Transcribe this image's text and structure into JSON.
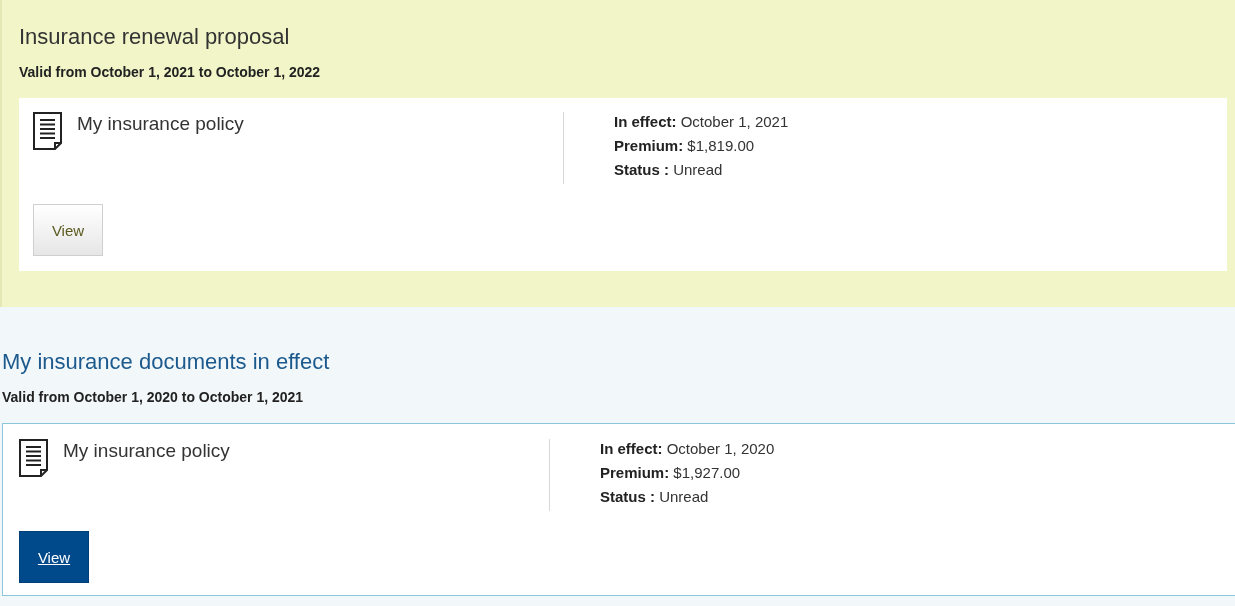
{
  "sections": [
    {
      "kind": "proposal",
      "title": "Insurance renewal proposal",
      "validity": "Valid from October 1, 2021 to October 1, 2022",
      "document": {
        "title": "My insurance policy",
        "details": [
          "**In effect:** October 1, 2021",
          "**Premium:** $1,819.00",
          "**Status :** Unread"
        ],
        "button": "View"
      }
    },
    {
      "kind": "in_effect",
      "title": "My insurance documents in effect",
      "validity": "Valid from October 1, 2020 to October 1, 2021",
      "document": {
        "title": "My insurance policy",
        "details": [
          "**In effect:** October 1, 2020",
          "**Premium:** $1,927.00",
          "**Status :** Unread"
        ],
        "button": "View"
      }
    }
  ]
}
